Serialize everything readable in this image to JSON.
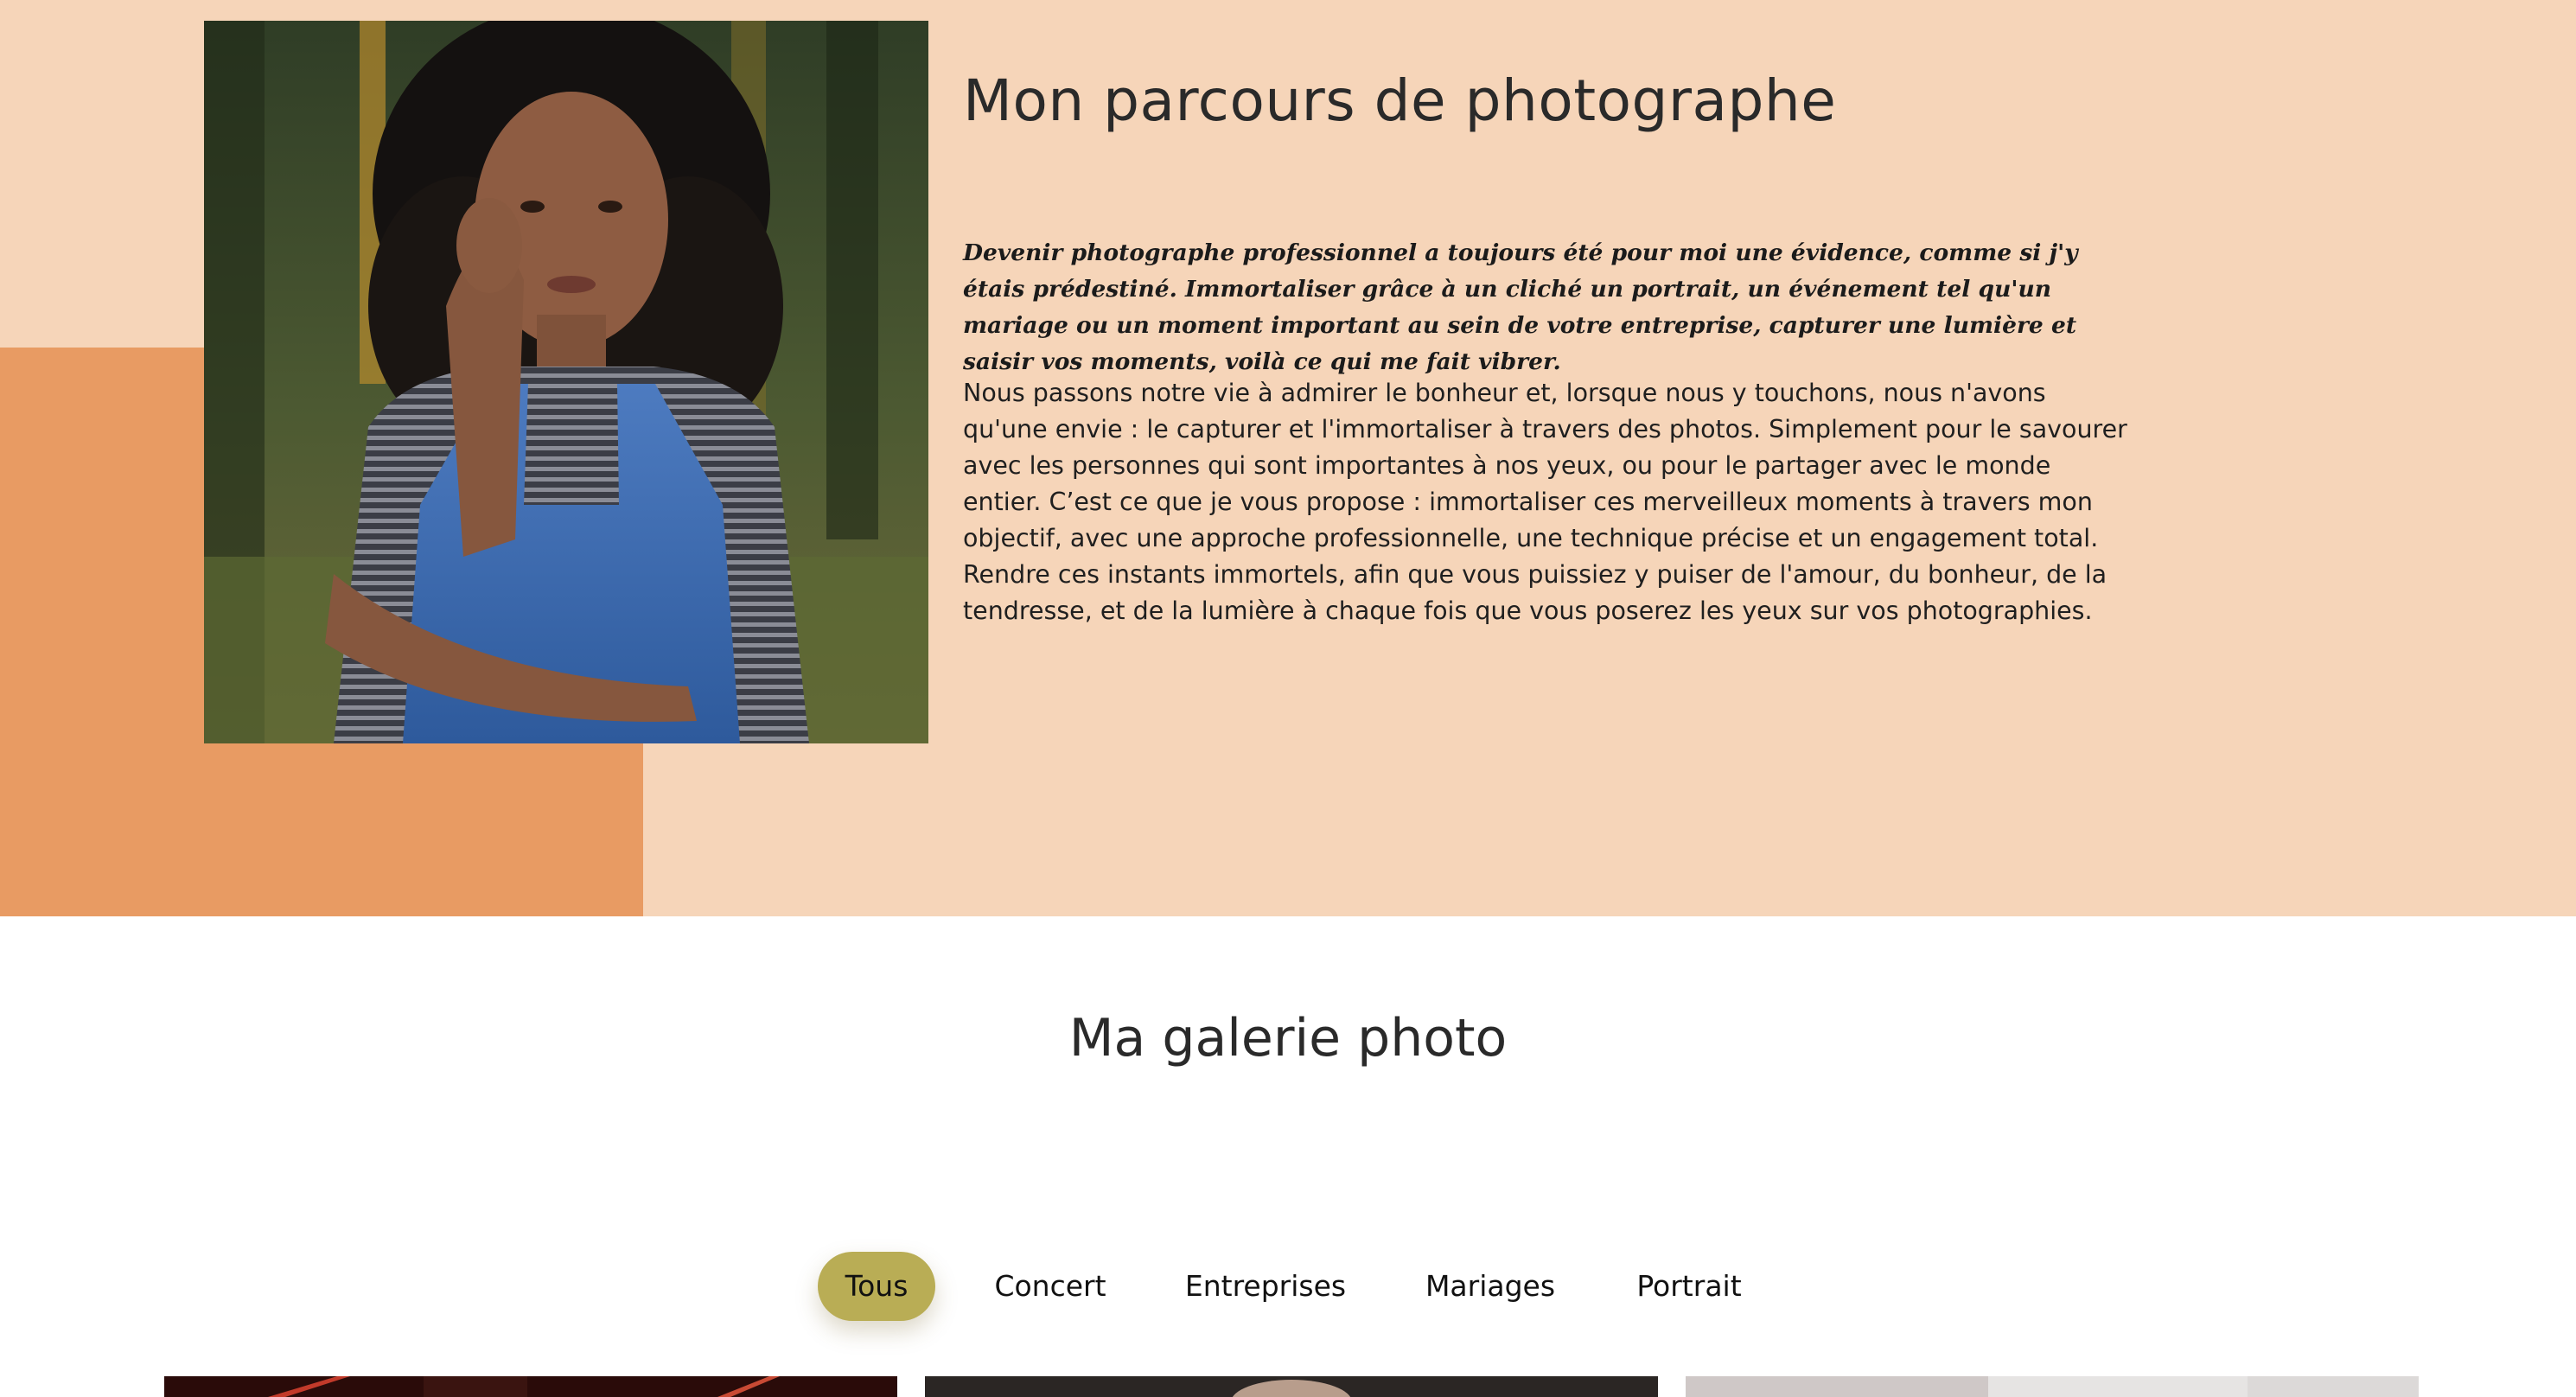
{
  "about": {
    "title": "Mon parcours de photographe",
    "quote": "Devenir photographe professionnel a toujours été pour moi une évidence, comme si j'y étais prédestiné. Immortaliser grâce à un cliché un portrait, un événement tel qu'un mariage ou un moment important au sein de votre entreprise, capturer une lumière et saisir vos moments, voilà ce qui me fait vibrer.",
    "body": "Nous passons notre vie à admirer le bonheur et, lorsque nous y touchons, nous n'avons qu'une envie : le capturer et l'immortaliser à travers des photos. Simplement pour le savourer avec les personnes qui sont importantes à nos yeux, ou pour le partager avec le monde entier. C’est ce que je vous propose : immortaliser ces merveilleux moments à travers mon objectif, avec une approche professionnelle, une technique précise et un engagement total. Rendre ces instants immortels, afin que vous puissiez y puiser de l'amour, du bonheur, de la tendresse, et de la lumière à chaque fois que vous poserez les yeux sur vos photographies.",
    "colors": {
      "background": "#f6d5b9",
      "accent_block": "#e89b63"
    }
  },
  "gallery": {
    "title": "Ma galerie photo",
    "filters": [
      {
        "label": "Tous",
        "active": true
      },
      {
        "label": "Concert",
        "active": false
      },
      {
        "label": "Entreprises",
        "active": false
      },
      {
        "label": "Mariages",
        "active": false
      },
      {
        "label": "Portrait",
        "active": false
      }
    ],
    "active_color": "#b9ad55"
  }
}
